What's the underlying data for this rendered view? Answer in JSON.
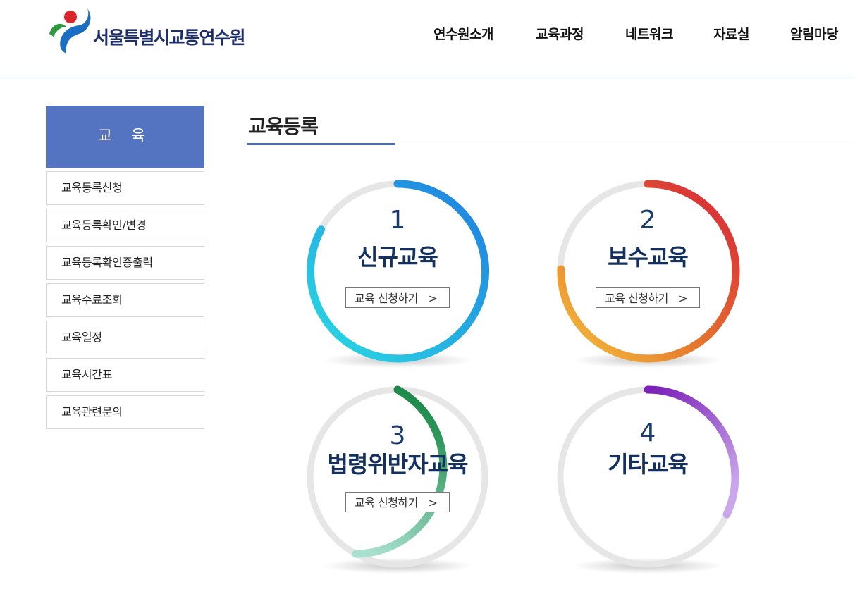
{
  "site": {
    "logo_text": "서울특별시교통연수원",
    "logo_icon": "seoul-emblem-icon"
  },
  "gnb": [
    {
      "label": "연수원소개"
    },
    {
      "label": "교육과정"
    },
    {
      "label": "네트워크"
    },
    {
      "label": "자료실"
    },
    {
      "label": "알림마당"
    }
  ],
  "sidebar": {
    "title": "교 육",
    "items": [
      {
        "label": "교육등록신청"
      },
      {
        "label": "교육등록확인/변경"
      },
      {
        "label": "교육등록확인증출력"
      },
      {
        "label": "교육수료조회"
      },
      {
        "label": "교육일정"
      },
      {
        "label": "교육시간표"
      },
      {
        "label": "교육관련문의"
      }
    ]
  },
  "content": {
    "title": "교육등록",
    "cards": [
      {
        "number": "1",
        "name": "신규교육",
        "button": "교육 신청하기",
        "arrow": ">",
        "colors": [
          "#1f7ee0",
          "#2adbe3"
        ]
      },
      {
        "number": "2",
        "name": "보수교육",
        "button": "교육 신청하기",
        "arrow": ">",
        "colors": [
          "#d6223b",
          "#f4b43c"
        ]
      },
      {
        "number": "3",
        "name": "법령위반자교육",
        "button": "교육 신청하기",
        "arrow": ">",
        "colors": [
          "#1d8a4a",
          "#9fdac7"
        ]
      },
      {
        "number": "4",
        "name": "기타교육",
        "colors": [
          "#7a1fb8",
          "#c9a7ea"
        ]
      }
    ]
  },
  "colors": {
    "accent": "#5473c1",
    "title_text": "#14305e",
    "ring_track": "#e6e6e6"
  }
}
